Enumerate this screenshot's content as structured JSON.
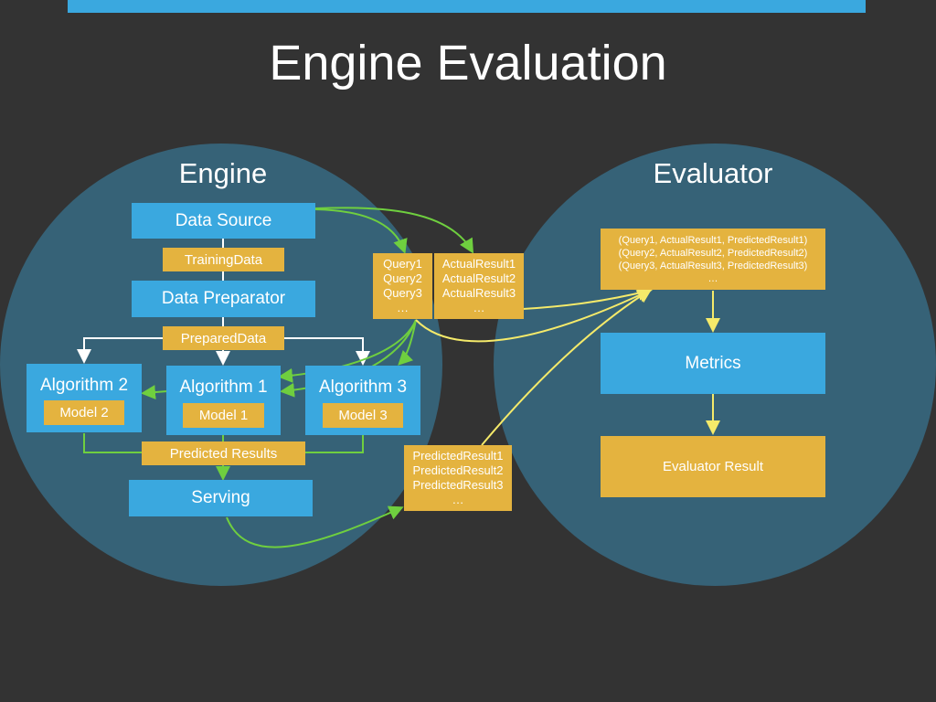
{
  "slide": {
    "title": "Engine Evaluation",
    "accent": "#3aa8df",
    "box_color": "#e4b33f",
    "circle_color": "#366277"
  },
  "engine": {
    "title": "Engine",
    "data_source": "Data Source",
    "training_data": "TrainingData",
    "data_preparator": "Data Preparator",
    "prepared_data": "PreparedData",
    "algorithms": [
      {
        "name": "Algorithm 2",
        "model": "Model 2"
      },
      {
        "name": "Algorithm 1",
        "model": "Model 1"
      },
      {
        "name": "Algorithm 3",
        "model": "Model 3"
      }
    ],
    "predicted_results": "Predicted Results",
    "serving": "Serving"
  },
  "queries": [
    "Query1",
    "Query2",
    "Query3",
    "…"
  ],
  "actual_results": [
    "ActualResult1",
    "ActualResult2",
    "ActualResult3",
    "…"
  ],
  "predicted_list": [
    "PredictedResult1",
    "PredictedResult2",
    "PredictedResult3",
    "…"
  ],
  "evaluator": {
    "title": "Evaluator",
    "tuples": [
      "(Query1, ActualResult1, PredictedResult1)",
      "(Query2, ActualResult2, PredictedResult2)",
      "(Query3, ActualResult3, PredictedResult3)",
      "…"
    ],
    "metrics": "Metrics",
    "result": "Evaluator Result"
  }
}
